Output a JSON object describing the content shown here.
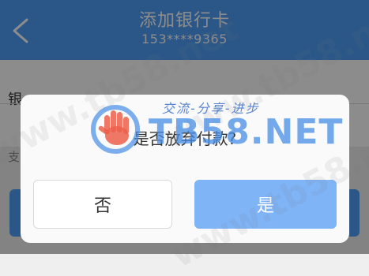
{
  "nav": {
    "title": "添加银行卡",
    "subtitle": "153****9365"
  },
  "page": {
    "row_label": "银",
    "row_hint": "支"
  },
  "dialog": {
    "message": "是否放弃付款?",
    "no_label": "否",
    "yes_label": "是"
  },
  "watermark": {
    "brand": "TB58.NET",
    "slogan": "交流-分享-进步",
    "url": "www.tb58.net"
  },
  "colors": {
    "accent": "#4f9ef8",
    "yes_button": "#7fb4f7"
  }
}
